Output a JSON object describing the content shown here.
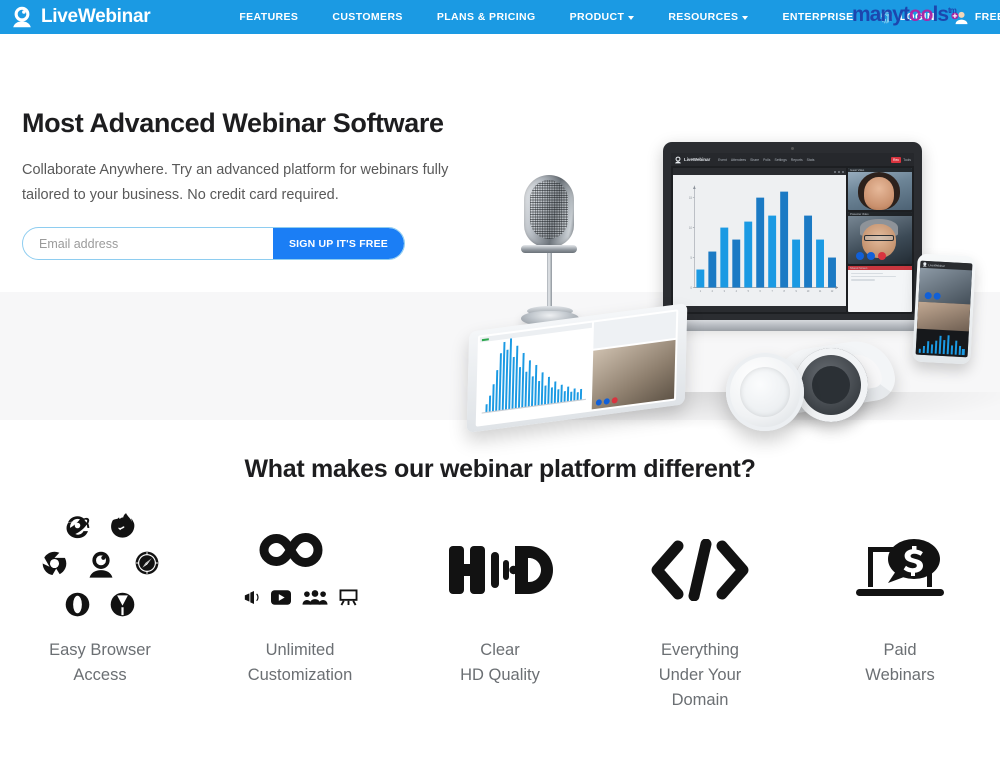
{
  "brand": {
    "name": "LiveWebinar",
    "logo_icon": "livewebinar-camera-logo-icon"
  },
  "nav": {
    "links": [
      {
        "label": "FEATURES",
        "has_caret": false
      },
      {
        "label": "CUSTOMERS",
        "has_caret": false
      },
      {
        "label": "PLANS & PRICING",
        "has_caret": false
      },
      {
        "label": "PRODUCT",
        "has_caret": true
      },
      {
        "label": "RESOURCES",
        "has_caret": true
      },
      {
        "label": "ENTERPRISE",
        "has_caret": false
      }
    ],
    "login": {
      "label": "LOGIN",
      "icon": "fingerprint-icon"
    },
    "signup": {
      "label": "FREE SIGN UP",
      "icon": "add-user-icon"
    },
    "bar_color": "#1b9ae3"
  },
  "watermark": {
    "text_start": "many",
    "text_mid": "t",
    "text_dot": "oo",
    "text_end": "ls",
    "tm": "tm",
    "full": "manytools"
  },
  "hero": {
    "title": "Most Advanced Webinar Software",
    "subtitle": "Collaborate Anywhere. Try an advanced platform for webinars fully tailored to your business. No credit card required.",
    "email_placeholder": "Email address",
    "email_value": "",
    "cta_label": "SIGN UP IT'S FREE",
    "cta_color": "#1b7ef5"
  },
  "device_mock": {
    "app_brand": "LiveWebinar",
    "menu": [
      "Event",
      "Attendees",
      "Share",
      "Polls",
      "Settings",
      "Reports",
      "Stats",
      "Tools"
    ],
    "record_label": "Rec",
    "tiles": [
      "Guest Video",
      "Presenter Video",
      "Shared Screen"
    ]
  },
  "chart_data": {
    "type": "bar",
    "title": "",
    "xlabel": "",
    "ylabel": "",
    "categories": [
      "1",
      "2",
      "3",
      "4",
      "5",
      "6",
      "7",
      "8",
      "9",
      "10",
      "11",
      "12"
    ],
    "values": [
      3,
      6,
      10,
      8,
      11,
      15,
      12,
      16,
      8,
      12,
      8,
      5
    ],
    "ylim": [
      0,
      17
    ],
    "yticks": [
      0,
      5,
      10,
      15
    ],
    "grid": false,
    "legend": false,
    "colors": [
      "#1b9ae3",
      "#1b7ac4"
    ]
  },
  "features": {
    "title": "What makes our webinar platform different?",
    "items": [
      {
        "label_line1": "Easy Browser",
        "label_line2": "Access",
        "icon": "browser-logos-group-icon",
        "sub_icons": [
          "internet-explorer-icon",
          "firefox-icon",
          "chrome-icon",
          "livewebinar-icon",
          "safari-icon",
          "opera-icon",
          "yandex-icon"
        ]
      },
      {
        "label_line1": "Unlimited",
        "label_line2": "Customization",
        "icon": "infinity-icon",
        "sub_icons": [
          "megaphone-icon",
          "youtube-icon",
          "people-group-icon",
          "easel-presentation-icon"
        ]
      },
      {
        "label_line1": "Clear",
        "label_line2": "HD Quality",
        "icon": "hd-quality-icon",
        "sub_icons": []
      },
      {
        "label_line1": "Everything",
        "label_line2": "Under Your",
        "label_line3": "Domain",
        "icon": "code-brackets-icon",
        "sub_icons": []
      },
      {
        "label_line1": "Paid",
        "label_line2": "Webinars",
        "icon": "laptop-dollar-icon",
        "sub_icons": []
      }
    ]
  }
}
